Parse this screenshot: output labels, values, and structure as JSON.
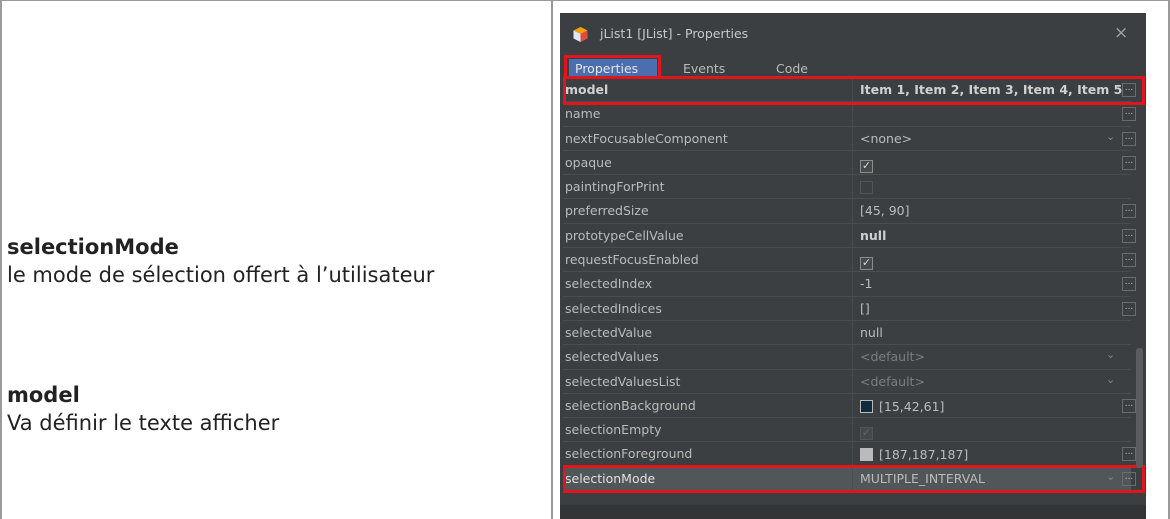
{
  "descriptions": {
    "selection_mode_title": "selectionMode",
    "selection_mode_text": "le mode de sélection offert à l’utilisateur",
    "model_title": "model",
    "model_text": "Va définir le texte afficher"
  },
  "window": {
    "title": "jList1 [JList] - Properties",
    "close_glyph": "×",
    "tabs": [
      "Properties",
      "Events",
      "Code"
    ],
    "active_tab": "Properties"
  },
  "properties": [
    {
      "name": "model",
      "value": "Item 1, Item 2, Item 3, Item 4, Item 5"
    },
    {
      "name": "name",
      "value": ""
    },
    {
      "name": "nextFocusableComponent",
      "value": "<none>"
    },
    {
      "name": "opaque",
      "value": "✓"
    },
    {
      "name": "paintingForPrint",
      "value": ""
    },
    {
      "name": "preferredSize",
      "value": "[45, 90]"
    },
    {
      "name": "prototypeCellValue",
      "value": "null"
    },
    {
      "name": "requestFocusEnabled",
      "value": "✓"
    },
    {
      "name": "selectedIndex",
      "value": "-1"
    },
    {
      "name": "selectedIndices",
      "value": "[]"
    },
    {
      "name": "selectedValue",
      "value": "null"
    },
    {
      "name": "selectedValues",
      "value": "<default>"
    },
    {
      "name": "selectedValuesList",
      "value": "<default>"
    },
    {
      "name": "selectionBackground",
      "value": "[15,42,61]"
    },
    {
      "name": "selectionEmpty",
      "value": "✓"
    },
    {
      "name": "selectionForeground",
      "value": "[187,187,187]"
    },
    {
      "name": "selectionMode",
      "value": "MULTIPLE_INTERVAL"
    }
  ],
  "dots_label": "...",
  "chevron_glyph": "⌄",
  "colors": {
    "highlight": "#e2151c",
    "panel_bg": "#3c3f41",
    "active_tab": "#4b6eaf",
    "selection_background_swatch": "#0f2a3d",
    "selection_foreground_swatch": "#bbbbbb"
  }
}
